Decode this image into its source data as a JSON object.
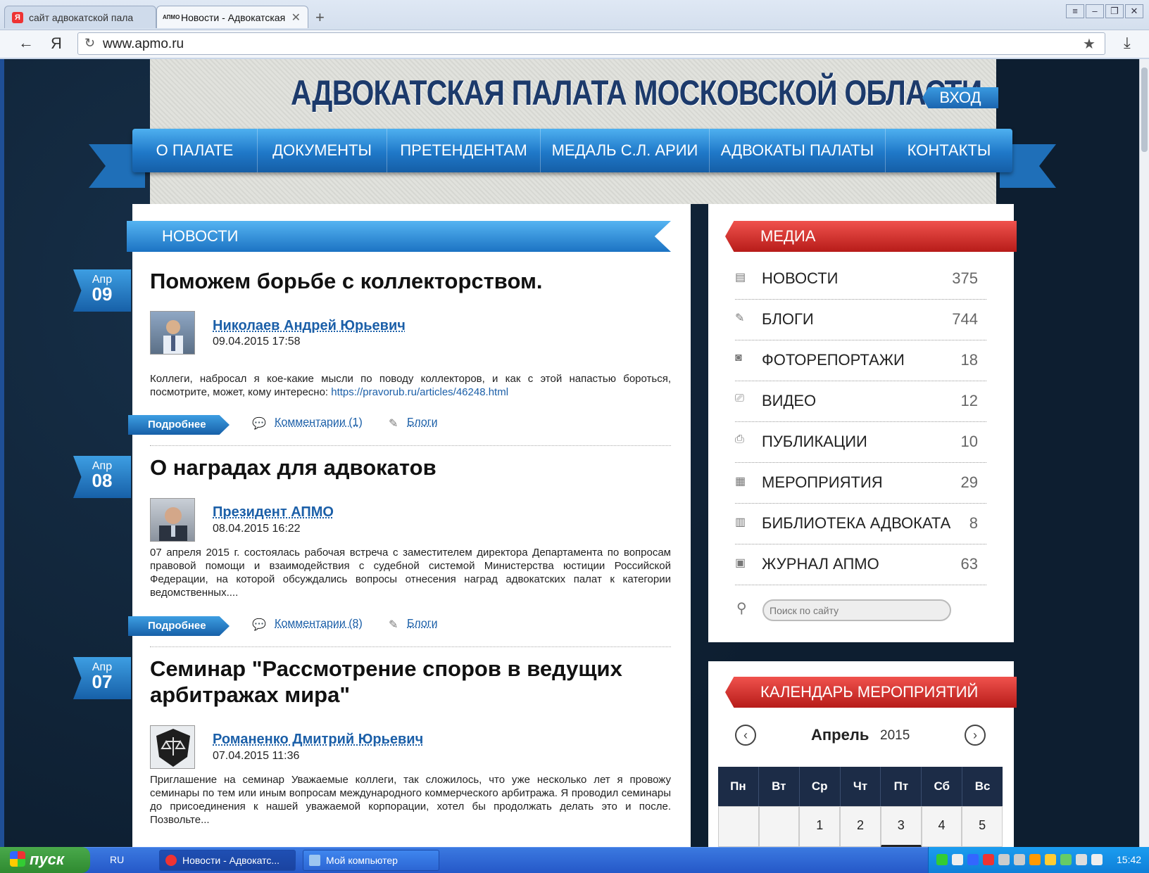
{
  "browser": {
    "tabs": [
      {
        "label": "сайт адвокатской пала",
        "favicon": "Я"
      },
      {
        "label": "Новости - Адвокатская",
        "favicon": "АПМО"
      }
    ],
    "new_tab_symbol": "+",
    "url": "www.apmo.ru"
  },
  "site": {
    "title": "АДВОКАТСКАЯ ПАЛАТА МОСКОВСКОЙ ОБЛАСТИ",
    "login_label": "ВХОД",
    "nav": [
      "О ПАЛАТЕ",
      "ДОКУМЕНТЫ",
      "ПРЕТЕНДЕНТАМ",
      "МЕДАЛЬ С.Л. АРИИ",
      "АДВОКАТЫ ПАЛАТЫ",
      "КОНТАКТЫ"
    ]
  },
  "news": {
    "heading": "НОВОСТИ",
    "more_label": "Подробнее",
    "blog_label": "Блоги",
    "items": [
      {
        "month": "Апр",
        "day": "09",
        "title": "Поможем борьбе с коллекторством.",
        "author": "Николаев Андрей Юрьевич",
        "datetime": "09.04.2015 17:58",
        "text": "Коллеги, набросал я кое-какие мысли по поводу коллекторов, и как с этой напастью бороться, посмотрите, может, кому интересно: ",
        "link": "https://pravorub.ru/articles/46248.html",
        "comments": "Комментарии (1)"
      },
      {
        "month": "Апр",
        "day": "08",
        "title": "О наградах для адвокатов",
        "author": "Президент АПМО",
        "datetime": "08.04.2015 16:22",
        "text": "07 апреля 2015 г. состоялась рабочая встреча с заместителем директора Департамента по вопросам правовой помощи и взаимодействия с судебной системой Министерства юстиции Российской Федерации, на которой обсуждались вопросы отнесения наград адвокатских палат к категории ведомственных....",
        "comments": "Комментарии (8)"
      },
      {
        "month": "Апр",
        "day": "07",
        "title": "Семинар \"Рассмотрение споров в ведущих арбитражах мира\"",
        "author": "Романенко Дмитрий Юрьевич",
        "datetime": "07.04.2015 11:36",
        "text": "Приглашение на семинар Уважаемые коллеги, так сложилось, что уже несколько лет я провожу семинары по тем или иным вопросам международного коммерческого арбитража. Я проводил семинары до присоединения к нашей уважаемой корпорации, хотел бы продолжать делать это и после. Позвольте..."
      }
    ]
  },
  "media": {
    "heading": "МЕДИА",
    "items": [
      {
        "icon": "newspaper-icon",
        "label": "НОВОСТИ",
        "count": "375"
      },
      {
        "icon": "pen-icon",
        "label": "БЛОГИ",
        "count": "744"
      },
      {
        "icon": "camera-icon",
        "label": "ФОТОРЕПОРТАЖИ",
        "count": "18"
      },
      {
        "icon": "tv-icon",
        "label": "ВИДЕО",
        "count": "12"
      },
      {
        "icon": "printer-icon",
        "label": "ПУБЛИКАЦИИ",
        "count": "10"
      },
      {
        "icon": "calendar-icon",
        "label": "МЕРОПРИЯТИЯ",
        "count": "29"
      },
      {
        "icon": "books-icon",
        "label": "БИБЛИОТЕКА АДВОКАТА",
        "count": "8"
      },
      {
        "icon": "book-icon",
        "label": "ЖУРНАЛ АПМО",
        "count": "63"
      }
    ],
    "search_placeholder": "Поиск по сайту"
  },
  "calendar": {
    "heading": "КАЛЕНДАРЬ МЕРОПРИЯТИЙ",
    "month": "Апрель",
    "year": "2015",
    "weekdays": [
      "Пн",
      "Вт",
      "Ср",
      "Чт",
      "Пт",
      "Сб",
      "Вс"
    ],
    "first_row": [
      "",
      "",
      "1",
      "2",
      "3",
      "4",
      "5"
    ]
  },
  "taskbar": {
    "start_label": "пуск",
    "language": "RU",
    "tasks": [
      "Новости - Адвокатс...",
      "Мой компьютер"
    ],
    "clock": "15:42"
  }
}
